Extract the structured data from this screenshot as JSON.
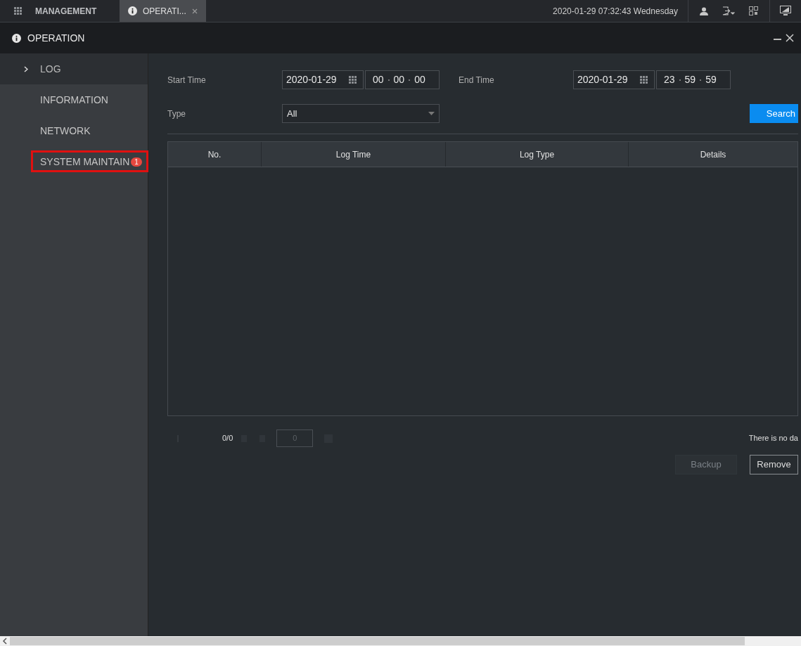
{
  "top_bar": {
    "menu_label": "MANAGEMENT",
    "tabs": [
      {
        "label": "OPERATI...",
        "selected": true
      }
    ],
    "datetime": "2020-01-29 07:32:43 Wednesday"
  },
  "window": {
    "title": "OPERATION"
  },
  "sidebar": {
    "items": [
      {
        "label": "LOG",
        "selected": true,
        "highlighted": false
      },
      {
        "label": "INFORMATION",
        "selected": false,
        "highlighted": false
      },
      {
        "label": "NETWORK",
        "selected": false,
        "highlighted": false
      },
      {
        "label": "SYSTEM MAINTAIN",
        "selected": false,
        "highlighted": true,
        "badge": "1"
      }
    ]
  },
  "form": {
    "start_label": "Start Time",
    "start_date": "2020-01-29",
    "start_time": [
      "00",
      "00",
      "00"
    ],
    "end_label": "End Time",
    "end_date": "2020-01-29",
    "end_time": [
      "23",
      "59",
      "59"
    ],
    "type_label": "Type",
    "type_value": "All",
    "search_button": "Search"
  },
  "table": {
    "columns": [
      "No.",
      "Log Time",
      "Log Type",
      "Details"
    ]
  },
  "pager": {
    "page": "0/0",
    "page_input": "0",
    "status": "There is no da"
  },
  "buttons": [
    {
      "label": "Backup",
      "disabled": true
    },
    {
      "label": "Remove",
      "disabled": false
    }
  ]
}
